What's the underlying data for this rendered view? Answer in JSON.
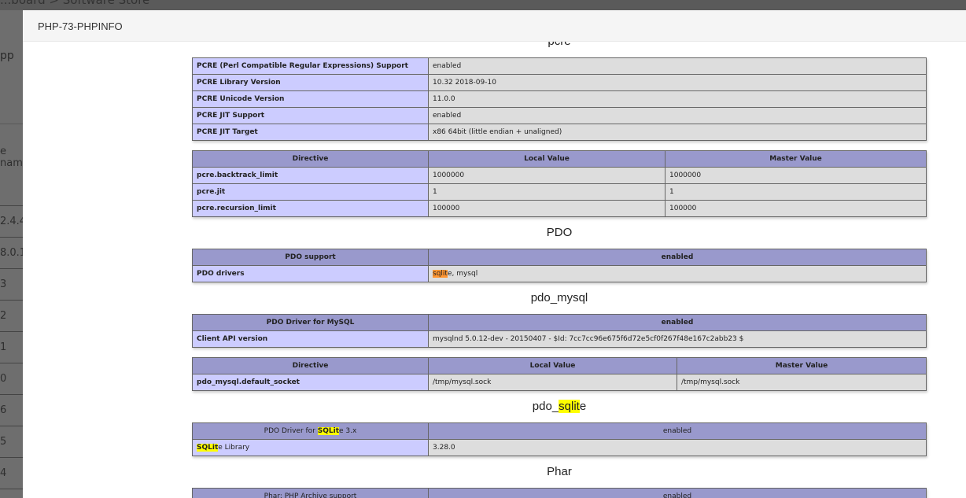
{
  "background": {
    "breadcrumb": "...board  >  Software Store",
    "app_fragment": "pp",
    "column_fragment": "e nam",
    "row_fragments": [
      "2.4.4",
      "8.0.1",
      "3",
      "2",
      "1",
      "0",
      "6",
      "5",
      "4",
      ""
    ]
  },
  "modal": {
    "title": "PHP-73-PHPINFO"
  },
  "sections": {
    "pcre": {
      "heading": "pcre",
      "info": [
        [
          "PCRE (Perl Compatible Regular Expressions) Support",
          "enabled"
        ],
        [
          "PCRE Library Version",
          "10.32 2018-09-10"
        ],
        [
          "PCRE Unicode Version",
          "11.0.0"
        ],
        [
          "PCRE JIT Support",
          "enabled"
        ],
        [
          "PCRE JIT Target",
          "x86 64bit (little endian + unaligned)"
        ]
      ],
      "directive_headers": [
        "Directive",
        "Local Value",
        "Master Value"
      ],
      "directives": [
        [
          "pcre.backtrack_limit",
          "1000000",
          "1000000"
        ],
        [
          "pcre.jit",
          "1",
          "1"
        ],
        [
          "pcre.recursion_limit",
          "100000",
          "100000"
        ]
      ]
    },
    "pdo": {
      "heading": "PDO",
      "header": [
        "PDO support",
        "enabled"
      ],
      "drivers_label": "PDO drivers",
      "drivers_highlight": "sqlit",
      "drivers_rest": "e, mysql"
    },
    "pdo_mysql": {
      "heading": "pdo_mysql",
      "header": [
        "PDO Driver for MySQL",
        "enabled"
      ],
      "info": [
        [
          "Client API version",
          "mysqlnd 5.0.12-dev - 20150407 - $Id: 7cc7cc96e675f6d72e5cf0f267f48e167c2abb23 $"
        ]
      ],
      "directive_headers": [
        "Directive",
        "Local Value",
        "Master Value"
      ],
      "directives": [
        [
          "pdo_mysql.default_socket",
          "/tmp/mysql.sock",
          "/tmp/mysql.sock"
        ]
      ]
    },
    "pdo_sqlite": {
      "heading_pre": "pdo_",
      "heading_hl": "sqlit",
      "heading_post": "e",
      "header_pre": "PDO Driver for ",
      "header_hl": "SQLit",
      "header_post": "e 3.x",
      "header_value": "enabled",
      "lib_hl": "SQLit",
      "lib_post": "e Library",
      "lib_value": "3.28.0"
    },
    "phar": {
      "heading": "Phar",
      "header": [
        "Phar: PHP Archive support",
        "enabled"
      ]
    }
  },
  "colors": {
    "header_bg": "#9999cc",
    "label_bg": "#ccccff",
    "value_bg": "#dddddd",
    "search_highlight": "#ffff00",
    "current_highlight": "#ff9632"
  }
}
